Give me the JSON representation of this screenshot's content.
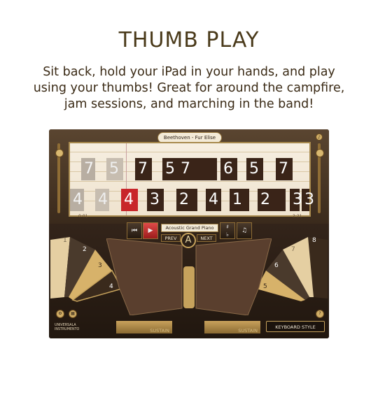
{
  "page": {
    "heading": "THUMB PLAY",
    "subtitle_lines": [
      "Sit back, hold your iPad in your hands, and play",
      "using your thumbs! Great for around the campfire,",
      "jam sessions, and marching in the band!"
    ]
  },
  "app": {
    "song_title": "Beethoven - Fur Elise",
    "time_elapsed": "0:01",
    "time_total": "2:21",
    "progress": 0.02,
    "instrument": "Acoustic Grand Piano",
    "prev_label": "PREV",
    "next_label": "NEXT",
    "center_letter": "A",
    "sharp_flat": "#\n♭",
    "sustain_left": "SUSTAIN",
    "sustain_right": "SUSTAIN",
    "keyboard_style": "KEYBOARD STYLE",
    "brand_lines": [
      "UNIVERSALA",
      "INSTRUMENTO"
    ],
    "help": "?",
    "accent_red": "#c8262a",
    "gold": "#c6a25c",
    "top_notes": [
      "7",
      "5",
      "7",
      "5",
      "7",
      "6",
      "5",
      "7"
    ],
    "bottom_notes": [
      "4",
      "4",
      "4",
      "3",
      "2",
      "4",
      "1",
      "2",
      "3",
      "3"
    ],
    "left_keys": [
      "1",
      "2",
      "3",
      "4"
    ],
    "right_keys": [
      "8",
      "7",
      "6",
      "5"
    ]
  },
  "icons": [
    "prev-icon",
    "play-icon",
    "sharp-flat-icon",
    "note-icon",
    "settings-icon",
    "grid-icon",
    "help-icon",
    "volume-icon"
  ]
}
